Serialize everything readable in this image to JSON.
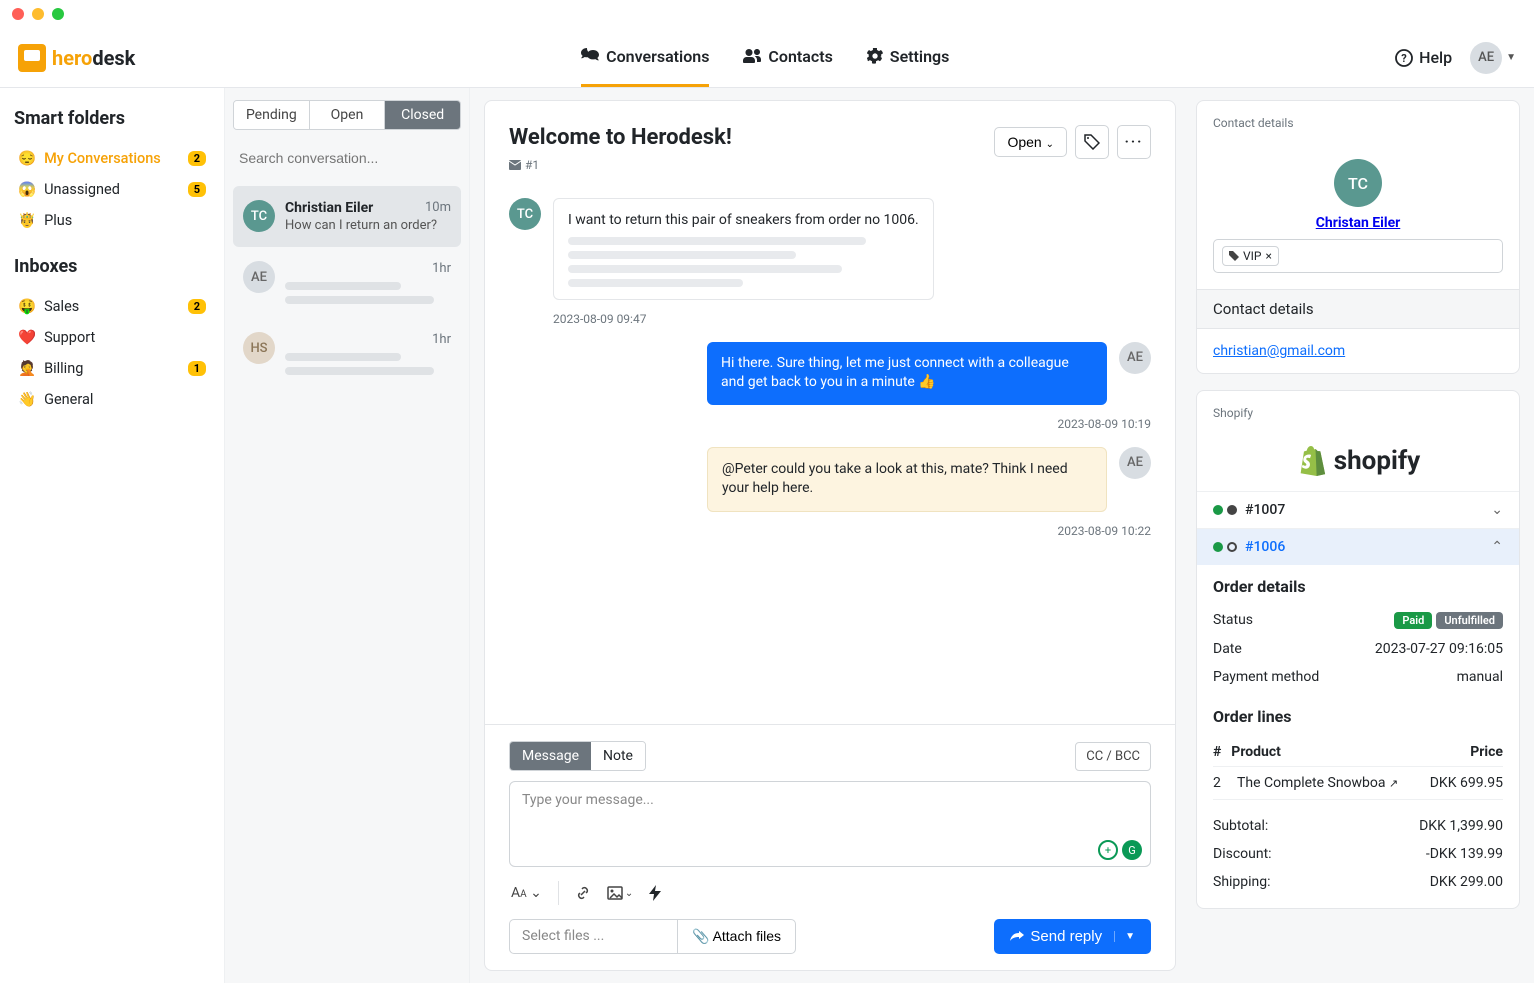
{
  "logo": {
    "hero": "hero",
    "desk": "desk"
  },
  "nav": {
    "conversations": "Conversations",
    "contacts": "Contacts",
    "settings": "Settings"
  },
  "topbar": {
    "help": "Help",
    "user_initials": "AE"
  },
  "sidebar": {
    "smart_folders_heading": "Smart folders",
    "smart_folders": [
      {
        "emoji": "😔",
        "label": "My Conversations",
        "count": "2",
        "active": true
      },
      {
        "emoji": "😱",
        "label": "Unassigned",
        "count": "5"
      },
      {
        "emoji": "🤴",
        "label": "Plus"
      }
    ],
    "inboxes_heading": "Inboxes",
    "inboxes": [
      {
        "emoji": "🤑",
        "label": "Sales",
        "count": "2"
      },
      {
        "emoji": "❤️",
        "label": "Support"
      },
      {
        "emoji": "🤦",
        "label": "Billing",
        "count": "1"
      },
      {
        "emoji": "👋",
        "label": "General"
      }
    ]
  },
  "conv_list": {
    "tabs": {
      "pending": "Pending",
      "open": "Open",
      "closed": "Closed"
    },
    "search_placeholder": "Search conversation...",
    "items": [
      {
        "initials": "TC",
        "name": "Christian Eiler",
        "time": "10m",
        "preview": "How can I return an order?",
        "selected": true,
        "av_class": "teal"
      },
      {
        "initials": "AE",
        "time": "1hr",
        "av_class": "gray"
      },
      {
        "initials": "HS",
        "time": "1hr",
        "av_class": "tan"
      }
    ]
  },
  "thread": {
    "title": "Welcome to Herodesk!",
    "id": "#1",
    "status_label": "Open",
    "messages": [
      {
        "side": "left",
        "av": "TC",
        "av_class": "teal",
        "text": "I want to return this pair of sneakers from order no 1006.",
        "time": "2023-08-09 09:47",
        "kind": "gray",
        "has_placeholders": true
      },
      {
        "side": "right",
        "av": "AE",
        "av_class": "gray",
        "text": "Hi there. Sure thing, let me just connect with a colleague and get back to you in a minute 👍",
        "time": "2023-08-09 10:19",
        "kind": "blue"
      },
      {
        "side": "right",
        "av": "AE",
        "av_class": "gray",
        "text": "@Peter could you take a look at this, mate? Think I need your help here.",
        "time": "2023-08-09 10:22",
        "kind": "note"
      }
    ],
    "composer": {
      "message_tab": "Message",
      "note_tab": "Note",
      "ccbcc": "CC / BCC",
      "placeholder": "Type your message...",
      "select_files": "Select files ...",
      "attach_files": "Attach files",
      "send": "Send reply"
    }
  },
  "right": {
    "contact_details_label": "Contact details",
    "contact_initials": "TC",
    "contact_name": "Christan Eiler",
    "vip_tag": "VIP",
    "contact_details_heading": "Contact details",
    "email": "christian@gmail.com",
    "shopify_label": "Shopify",
    "shopify_text": "shopify",
    "orders": [
      {
        "id": "#1007",
        "dots": [
          "green",
          "dark"
        ],
        "expanded": false
      },
      {
        "id": "#1006",
        "dots": [
          "green",
          "open"
        ],
        "expanded": true
      }
    ],
    "order_details": {
      "heading": "Order details",
      "status_label": "Status",
      "paid": "Paid",
      "unfulfilled": "Unfulfilled",
      "date_label": "Date",
      "date": "2023-07-27 09:16:05",
      "payment_label": "Payment method",
      "payment": "manual"
    },
    "order_lines": {
      "heading": "Order lines",
      "col_num": "#",
      "col_product": "Product",
      "col_price": "Price",
      "rows": [
        {
          "qty": "2",
          "product": "The Complete Snowboa",
          "price": "DKK 699.95"
        }
      ],
      "subtotal_label": "Subtotal:",
      "subtotal": "DKK 1,399.90",
      "discount_label": "Discount:",
      "discount": "-DKK 139.99",
      "shipping_label": "Shipping:",
      "shipping": "DKK 299.00"
    }
  }
}
